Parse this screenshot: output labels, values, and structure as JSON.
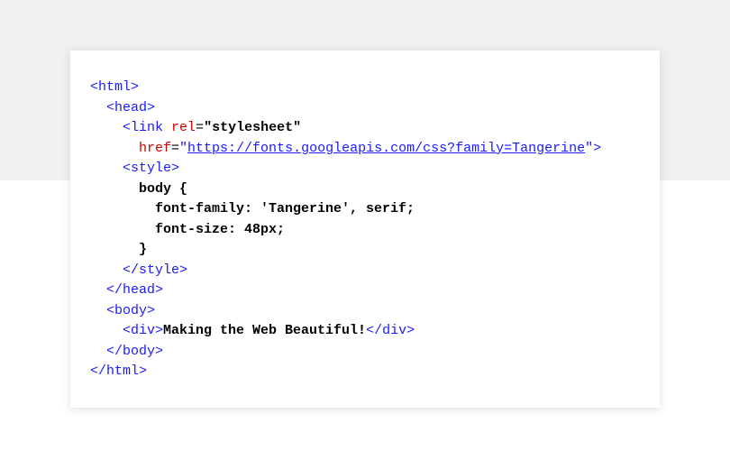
{
  "code": {
    "html_open": "<html>",
    "head_open": "<head>",
    "link_open": "<link",
    "rel_name": "rel",
    "rel_value": "\"stylesheet\"",
    "href_name": "href",
    "eq": "=",
    "quote_open": "\"",
    "href_url": "https://fonts.googleapis.com/css?family=Tangerine",
    "quote_close_gt": "\">",
    "style_open": "<style>",
    "css_selector": "body {",
    "css_rule1": "font-family: 'Tangerine', serif;",
    "css_rule2": "font-size: 48px;",
    "css_close": "}",
    "style_close": "</style>",
    "head_close": "</head>",
    "body_open": "<body>",
    "div_open": "<div>",
    "div_text": "Making the Web Beautiful!",
    "div_close": "</div>",
    "body_close": "</body>",
    "html_close": "</html>"
  }
}
